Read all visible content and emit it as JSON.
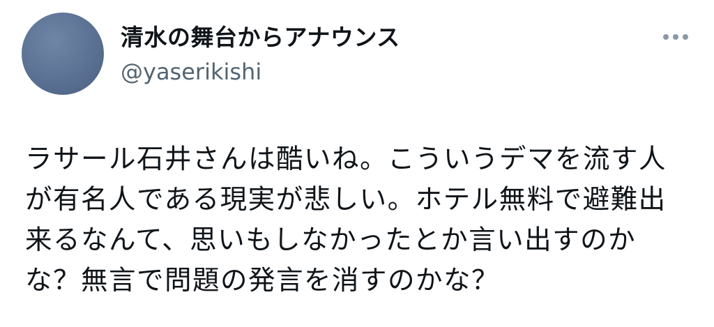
{
  "tweet": {
    "author": {
      "display_name": "清水の舞台からアナウンス",
      "handle": "@yaserikishi",
      "avatar_color": "#5a7193"
    },
    "more_icon": "more-horizontal-icon",
    "text_lines": [
      "ラサール石井さんは酷いね。こういうデマを流す人",
      "が有名人である現実が悲しい。ホテル無料で避難出",
      "来るなんて、思いもしなかったとか言い出すのか",
      "な？無言で問題の発言を消すのかな？"
    ],
    "colors": {
      "text": "#0f1419",
      "secondary": "#536471",
      "more_dots": "#8b98a5"
    }
  }
}
